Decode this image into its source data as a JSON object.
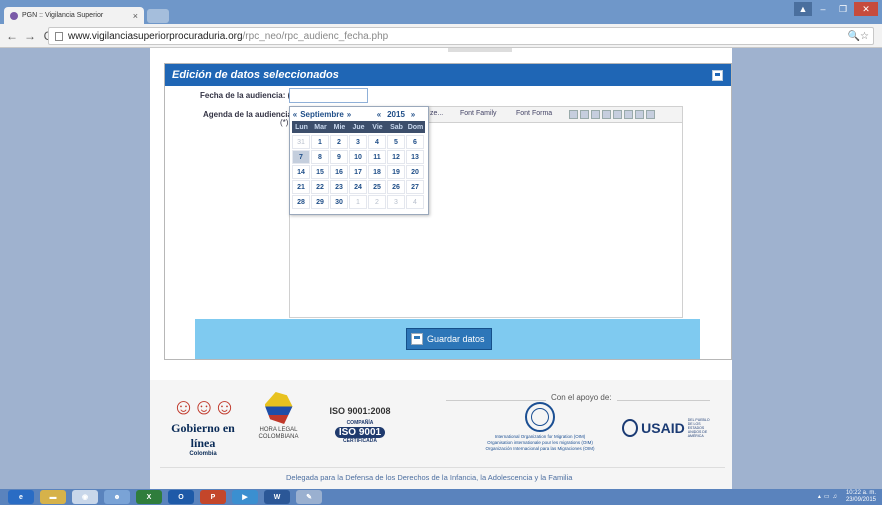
{
  "browser": {
    "tab_title": "PGN :: Vigilancia Superior",
    "url_host": "www.vigilanciasuperiorprocuraduria.org",
    "url_path": "/rpc_neo/rpc_audienc_fecha.php"
  },
  "panel": {
    "title": "Edición de datos seleccionados",
    "fecha_label": "Fecha de la audiencia: (*)",
    "fecha_value": "",
    "agenda_label": "Agenda de la audiencia:",
    "agenda_required": "(*)",
    "save_button": "Guardar datos"
  },
  "editor": {
    "font_size_dd": "ze...",
    "font_family_dd": "Font Family",
    "font_format_dd": "Font Forma"
  },
  "calendar": {
    "prev_month": "«",
    "month": "Septiembre",
    "next_month": "»",
    "prev_year": "«",
    "year": "2015",
    "next_year": "»",
    "weekdays": [
      "Lun",
      "Mar",
      "Mie",
      "Jue",
      "Vie",
      "Sab",
      "Dom"
    ],
    "days": [
      [
        "31",
        "1",
        "2",
        "3",
        "4",
        "5",
        "6"
      ],
      [
        "7",
        "8",
        "9",
        "10",
        "11",
        "12",
        "13"
      ],
      [
        "14",
        "15",
        "16",
        "17",
        "18",
        "19",
        "20"
      ],
      [
        "21",
        "22",
        "23",
        "24",
        "25",
        "26",
        "27"
      ],
      [
        "28",
        "29",
        "30",
        "1",
        "2",
        "3",
        "4"
      ]
    ],
    "outside": [
      [
        0,
        0
      ],
      [
        4,
        3
      ],
      [
        4,
        4
      ],
      [
        4,
        5
      ],
      [
        4,
        6
      ]
    ],
    "selected": [
      1,
      0
    ]
  },
  "footer": {
    "apoyo": "Con el apoyo de:",
    "gobierno_title": "Gobierno en línea",
    "gobierno_sub": "Colombia",
    "hora_legal": [
      "HORA LEGAL",
      "COLOMBIANA"
    ],
    "iso_title": "ISO 9001:2008",
    "iso_company": "COMPAÑÍA",
    "iso_big": "ISO 9001",
    "iso_cert": "CERTIFICADA",
    "oim_lines": [
      "International Organization for Migration (OIM)",
      "Organisation internationale pour les migrations (OIM)",
      "Organización Internacional para las Migraciones (OIM)"
    ],
    "usaid": "USAID",
    "usaid_sub": "DEL PUEBLO DE LOS ESTADOS UNIDOS DE AMÉRICA",
    "delegada": "Delegada para la Defensa de los Derechos de la Infancia, la Adolescencia y la Familia"
  },
  "taskbar": {
    "time": "10:22 a. m.",
    "date": "23/09/2015"
  }
}
